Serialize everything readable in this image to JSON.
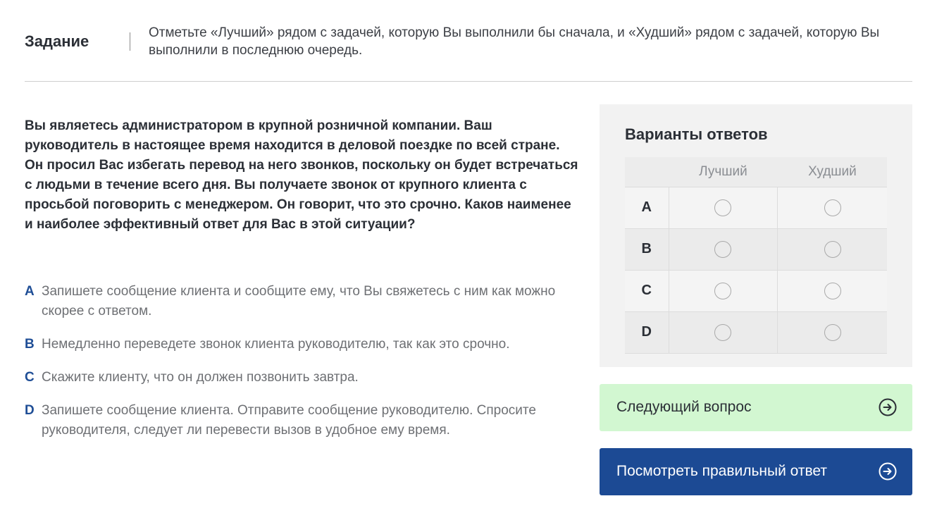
{
  "task": {
    "label": "Задание",
    "text": "Отметьте «Лучший» рядом с задачей, которую Вы выполнили бы сначала, и «Худший» рядом с задачей, которую Вы выполнили в последнюю очередь."
  },
  "question": "Вы являетесь администратором в крупной розничной компании. Ваш руководитель в настоящее время находится в деловой поездке по всей стране. Он просил Вас избегать перевод на него звонков, поскольку он будет встречаться с людьми в течение всего дня. Вы получаете звонок от крупного клиента с просьбой поговорить с менеджером. Он говорит, что это срочно. Каков наименее и наиболее эффективный ответ для Вас в этой ситуации?",
  "options": [
    {
      "letter": "A",
      "text": "Запишете сообщение клиента и сообщите ему, что Вы свяжетесь с ним как можно скорее с ответом."
    },
    {
      "letter": "B",
      "text": "Немедленно переведете звонок клиента руководителю, так как это срочно."
    },
    {
      "letter": "C",
      "text": "Скажите клиенту, что он должен позвонить завтра."
    },
    {
      "letter": "D",
      "text": "Запишете сообщение клиента. Отправите сообщение руководителю. Спросите руководителя, следует ли перевести вызов в удобное ему время."
    }
  ],
  "answers": {
    "title": "Варианты ответов",
    "col_best": "Лучший",
    "col_worst": "Худший",
    "rows": [
      "A",
      "B",
      "C",
      "D"
    ]
  },
  "buttons": {
    "next": "Следующий вопрос",
    "show_answer": "Посмотреть правильный ответ"
  },
  "colors": {
    "accent_blue": "#1c4a94",
    "next_bg": "#d2f7d1",
    "panel_bg": "#f2f2f2"
  },
  "icons": {
    "button_icon": "arrow-right-circle-icon"
  }
}
